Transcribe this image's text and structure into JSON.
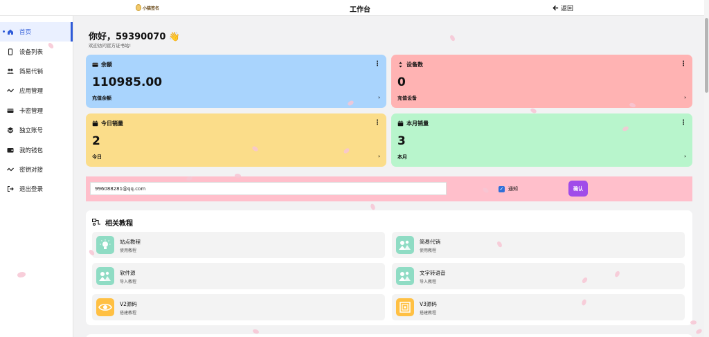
{
  "header": {
    "logo_text": "小猫签名",
    "title": "工作台",
    "back_label": "返回"
  },
  "sidebar": {
    "items": [
      {
        "label": "首页",
        "icon": "home-icon",
        "active": true
      },
      {
        "label": "设备列表",
        "icon": "phone-icon"
      },
      {
        "label": "简易代销",
        "icon": "users-icon"
      },
      {
        "label": "应用管理",
        "icon": "chart-line-icon"
      },
      {
        "label": "卡密管理",
        "icon": "credit-card-icon"
      },
      {
        "label": "独立账号",
        "icon": "layers-icon"
      },
      {
        "label": "我的钱包",
        "icon": "wallet-icon"
      },
      {
        "label": "密钥对接",
        "icon": "chart-line-icon"
      },
      {
        "label": "退出登录",
        "icon": "logout-icon"
      }
    ]
  },
  "greeting": {
    "title": "你好，59390070 👋",
    "subtitle": "欢迎访问官方证书站!"
  },
  "cards": {
    "balance": {
      "title": "余额",
      "value": "110985.00",
      "footer": "充值余额",
      "color": "#a9d4fd"
    },
    "devices": {
      "title": "设备数",
      "value": "0",
      "footer": "充值设备",
      "color": "#ffb3b3"
    },
    "today_sales": {
      "title": "今日销量",
      "value": "2",
      "footer": "今日",
      "color": "#fbdd8a"
    },
    "month_sales": {
      "title": "本月销量",
      "value": "3",
      "footer": "本月",
      "color": "#b8f5cc"
    }
  },
  "notify": {
    "email": "996088281@qq.com",
    "checkbox_label": "通知",
    "checked": true,
    "confirm_label": "确认"
  },
  "tutorials": {
    "title": "相关教程",
    "items": [
      {
        "name": "站点教程",
        "desc": "使用教程",
        "icon": "lightbulb-icon"
      },
      {
        "name": "简易代销",
        "desc": "使用教程",
        "icon": "users-icon"
      },
      {
        "name": "软件源",
        "desc": "导入教程",
        "icon": "users-icon"
      },
      {
        "name": "文字转语音",
        "desc": "导入教程",
        "icon": "users-icon"
      },
      {
        "name": "V2源码",
        "desc": "搭建教程",
        "icon": "eye-icon"
      },
      {
        "name": "V3源码",
        "desc": "搭建教程",
        "icon": "qr-icon"
      }
    ]
  }
}
